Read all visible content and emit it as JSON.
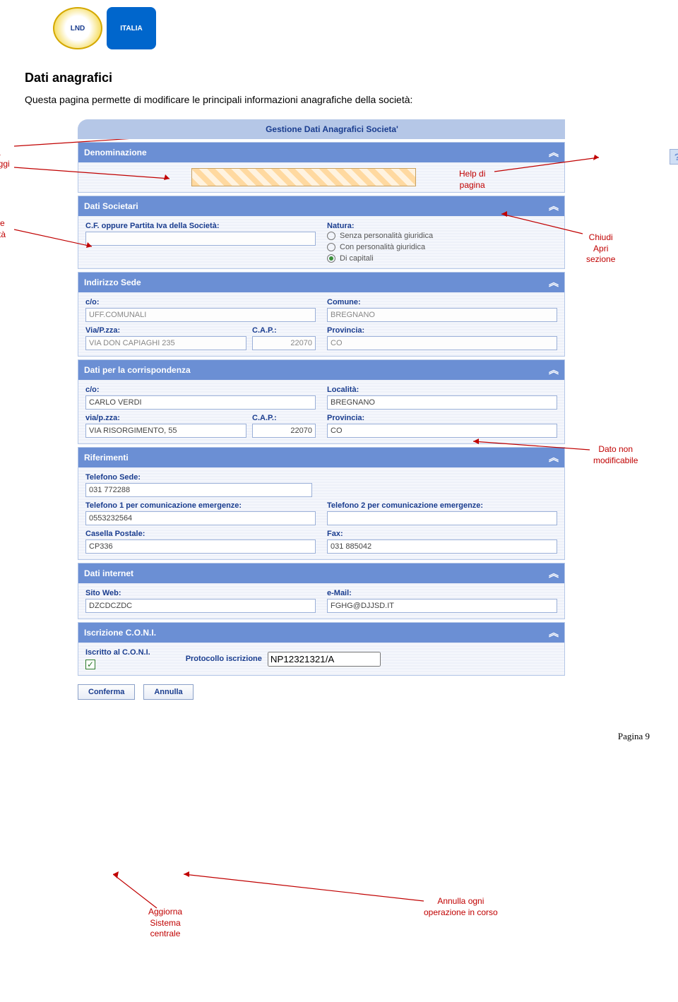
{
  "logos": {
    "lnd": "LND",
    "italia": "ITALIA"
  },
  "heading": "Dati anagrafici",
  "description": "Questa pagina permette di modificare le principali informazioni anagrafiche della società:",
  "gestione_title": "Gestione Dati Anagrafici Societa'",
  "callouts": {
    "area_messaggi": "Area\nmessaggi",
    "codice_societa": "Codice\nSocietà",
    "help_di_pagina": "Help di\npagina",
    "chiudi_apri": "Chiudi\nApri\nsezione",
    "dato_non_mod": "Dato non\nmodificabile",
    "annulla_op": "Annulla ogni\noperazione in corso",
    "aggiorna": "Aggiorna\nSistema\ncentrale"
  },
  "help_icon": "?",
  "sections": {
    "denominazione": {
      "title": "Denominazione"
    },
    "dati_societari": {
      "title": "Dati Societari",
      "cf_label": "C.F. oppure Partita Iva della Società:",
      "natura_label": "Natura:",
      "natura_options": [
        {
          "label": "Senza personalità giuridica",
          "selected": false
        },
        {
          "label": "Con personalità giuridica",
          "selected": false
        },
        {
          "label": "Di capitali",
          "selected": true
        }
      ]
    },
    "indirizzo_sede": {
      "title": "Indirizzo Sede",
      "co_label": "c/o:",
      "co_value": "UFF.COMUNALI",
      "comune_label": "Comune:",
      "comune_value": "BREGNANO",
      "via_label": "Via/P.zza:",
      "via_value": "VIA DON CAPIAGHI 235",
      "cap_label": "C.A.P.:",
      "cap_value": "22070",
      "prov_label": "Provincia:",
      "prov_value": "CO"
    },
    "corrispondenza": {
      "title": "Dati per la corrispondenza",
      "co_label": "c/o:",
      "co_value": "CARLO VERDI",
      "loc_label": "Località:",
      "loc_value": "BREGNANO",
      "via_label": "via/p.zza:",
      "via_value": "VIA RISORGIMENTO, 55",
      "cap_label": "C.A.P.:",
      "cap_value": "22070",
      "prov_label": "Provincia:",
      "prov_value": "CO"
    },
    "riferimenti": {
      "title": "Riferimenti",
      "tel_sede_label": "Telefono Sede:",
      "tel_sede_value": "031 772288",
      "tel1_label": "Telefono 1 per comunicazione emergenze:",
      "tel1_value": "0553232564",
      "tel2_label": "Telefono 2 per comunicazione emergenze:",
      "tel2_value": "",
      "casella_label": "Casella Postale:",
      "casella_value": "CP336",
      "fax_label": "Fax:",
      "fax_value": "031 885042"
    },
    "internet": {
      "title": "Dati internet",
      "sito_label": "Sito Web:",
      "sito_value": "DZCDCZDC",
      "email_label": "e-Mail:",
      "email_value": "FGHG@DJJSD.IT"
    },
    "coni": {
      "title": "Iscrizione C.O.N.I.",
      "iscritto_label": "Iscritto al C.O.N.I.",
      "iscritto_checked": true,
      "protocollo_label": "Protocollo iscrizione",
      "protocollo_value": "NP12321321/A"
    }
  },
  "buttons": {
    "conferma": "Conferma",
    "annulla": "Annulla"
  },
  "page_number": "Pagina 9"
}
